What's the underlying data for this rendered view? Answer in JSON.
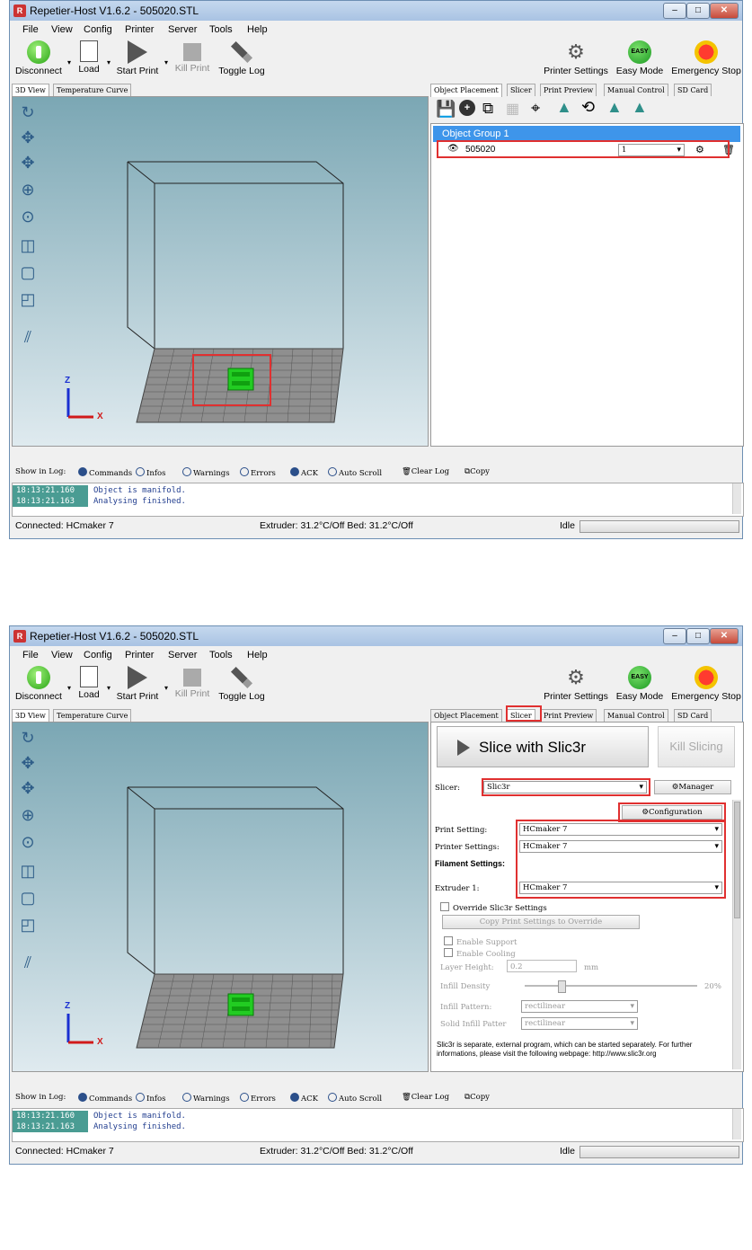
{
  "window_title": "Repetier-Host V1.6.2 - 505020.STL",
  "app_icon_letter": "R",
  "window_controls": {
    "minimize": "–",
    "maximize": "□",
    "close": "✕"
  },
  "menu": [
    "File",
    "View",
    "Config",
    "Printer",
    "Server",
    "Tools",
    "Help"
  ],
  "toolbar": {
    "disconnect": "Disconnect",
    "load": "Load",
    "start_print": "Start Print",
    "kill_print": "Kill Print",
    "toggle_log": "Toggle Log",
    "printer_settings": "Printer Settings",
    "easy_mode": "Easy Mode",
    "easy_badge": "EASY",
    "emergency_stop": "Emergency Stop"
  },
  "left_tabs": [
    "3D View",
    "Temperature Curve"
  ],
  "right_tabs": [
    "Object Placement",
    "Slicer",
    "Print Preview",
    "Manual Control",
    "SD Card"
  ],
  "axes": {
    "z": "Z",
    "x": "X"
  },
  "object_placement": {
    "group_name": "Object Group 1",
    "object_name": "505020",
    "copies": "1"
  },
  "slicer": {
    "slice_button": "Slice with Slic3r",
    "kill_button": "Kill Slicing",
    "slicer_label": "Slicer:",
    "slicer_value": "Slic3r",
    "manager_button": "Manager",
    "configuration_button": "Configuration",
    "print_setting_label": "Print Setting:",
    "print_setting_value": "HCmaker 7",
    "printer_settings_label": "Printer Settings:",
    "printer_settings_value": "HCmaker 7",
    "filament_settings_label": "Filament Settings:",
    "extruder_label": "Extruder 1:",
    "extruder_value": "HCmaker 7",
    "override_label": "Override Slic3r Settings",
    "copy_button": "Copy Print Settings to Override",
    "enable_support": "Enable Support",
    "enable_cooling": "Enable Cooling",
    "layer_height_label": "Layer Height:",
    "layer_height_value": "0.2",
    "layer_height_unit": "mm",
    "infill_density_label": "Infill Density",
    "infill_density_value": "20%",
    "infill_density_fraction": 0.2,
    "infill_pattern_label": "Infill Pattern:",
    "infill_pattern_value": "rectilinear",
    "solid_infill_label": "Solid Infill Patter",
    "solid_infill_value": "rectilinear",
    "note": "Slic3r is separate, external program, which can be started separately. For further informations, please visit the following webpage: http://www.slic3r.org"
  },
  "log_bar": {
    "show_in_log": "Show in Log:",
    "commands": "Commands",
    "infos": "Infos",
    "warnings": "Warnings",
    "errors": "Errors",
    "ack": "ACK",
    "auto_scroll": "Auto Scroll",
    "clear_log": "Clear Log",
    "copy": "Copy"
  },
  "log": [
    {
      "time": "18:13:21.160",
      "message": "Object is manifold."
    },
    {
      "time": "18:13:21.163",
      "message": "Analysing finished."
    }
  ],
  "status": {
    "connection": "Connected: HCmaker 7",
    "temps": "Extruder: 31.2°C/Off Bed: 31.2°C/Off",
    "state": "Idle"
  },
  "colors": {
    "highlight_box": "#e03030",
    "object_group": "#3e95ea",
    "model_green": "#22cc22"
  }
}
